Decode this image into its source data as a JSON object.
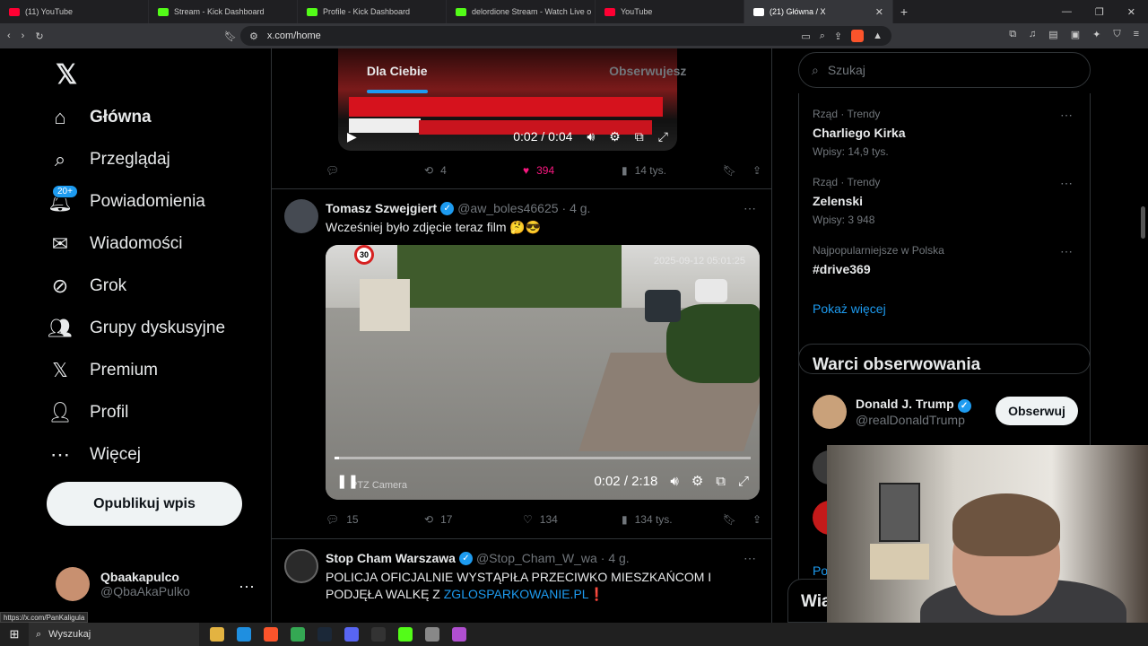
{
  "browser": {
    "tabs": [
      {
        "title": "(11) YouTube",
        "favicon": "youtube-icon"
      },
      {
        "title": "Stream - Kick Dashboard",
        "favicon": "kick-icon"
      },
      {
        "title": "Profile - Kick Dashboard",
        "favicon": "kick-icon"
      },
      {
        "title": "delordione Stream - Watch Live o",
        "favicon": "kick-icon"
      },
      {
        "title": "YouTube",
        "favicon": "youtube-icon"
      },
      {
        "title": "(21) Główna / X",
        "favicon": "x-icon"
      }
    ],
    "url": "x.com/home",
    "status_url": "https://x.com/PanKaligula"
  },
  "sidebar": {
    "items": [
      {
        "label": "Główna",
        "icon": "home-icon",
        "active": true
      },
      {
        "label": "Przeglądaj",
        "icon": "search-icon"
      },
      {
        "label": "Powiadomienia",
        "icon": "bell-icon",
        "badge": "20+"
      },
      {
        "label": "Wiadomości",
        "icon": "mail-icon"
      },
      {
        "label": "Grok",
        "icon": "grok-icon"
      },
      {
        "label": "Grupy dyskusyjne",
        "icon": "communities-icon"
      },
      {
        "label": "Premium",
        "icon": "x-premium-icon"
      },
      {
        "label": "Profil",
        "icon": "person-icon"
      },
      {
        "label": "Więcej",
        "icon": "more-circle-icon"
      }
    ],
    "publish_label": "Opublikuj wpis",
    "account": {
      "name": "Qbaakapulco",
      "handle": "@QbaAkaPulko"
    }
  },
  "feed": {
    "tabs": [
      {
        "label": "Dla Ciebie",
        "active": true
      },
      {
        "label": "Obserwujesz",
        "active": false
      }
    ],
    "first_video": {
      "time": "0:02 / 0:04"
    },
    "first_actions": {
      "replies": "",
      "reposts": "4",
      "likes": "394",
      "views": "14 tys."
    },
    "posts": [
      {
        "name": "Tomasz Szwejgiert",
        "handle": "@aw_boles46625",
        "age": "· 4 g.",
        "text": "Wcześniej było zdjęcie teraz film 🤔😎",
        "video": {
          "timestamp": "2025-09-12 05:01:25",
          "time": "0:02 / 2:18",
          "camera": "PTZ Camera",
          "sign": "30",
          "progress": 0.01
        },
        "actions": {
          "replies": "15",
          "reposts": "17",
          "likes": "134",
          "views": "134 tys."
        }
      },
      {
        "name": "Stop Cham Warszawa",
        "handle": "@Stop_Cham_W_wa",
        "age": "· 4 g.",
        "text": "POLICJA OFICJALNIE WYSTĄPIŁA PRZECIWKO MIESZKAŃCOM I PODJĘŁA WALKĘ Z",
        "link": "ZGLOSPARKOWANIE.PL",
        "emoji": "❗"
      }
    ]
  },
  "right": {
    "search_placeholder": "Szukaj",
    "trends": [
      {
        "category": "Rząd · Trendy",
        "title": "Charliego Kirka",
        "count": "Wpisy: 14,9 tys."
      },
      {
        "category": "Rząd · Trendy",
        "title": "Zelenski",
        "count": "Wpisy: 3 948"
      },
      {
        "category": "Najpopularniejsze w Polska",
        "title": "#drive369",
        "count": ""
      }
    ],
    "show_more": "Pokaż więcej",
    "follow_title": "Warci obserwowania",
    "follow_user": {
      "name": "Donald J. Trump",
      "handle": "@realDonaldTrump",
      "button": "Obserwuj"
    },
    "peek_text": "Po",
    "messages_peek": "Wia"
  },
  "taskbar": {
    "search": "Wyszukaj"
  },
  "colors": {
    "accent": "#1d9bf0",
    "like": "#f91880",
    "background": "#000000"
  }
}
